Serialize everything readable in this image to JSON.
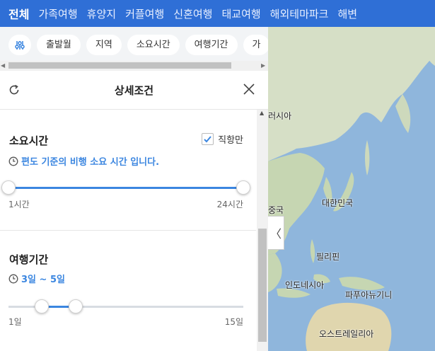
{
  "tabs": [
    "전체",
    "가족여행",
    "휴양지",
    "커플여행",
    "신혼여행",
    "태교여행",
    "해외테마파크",
    "해변"
  ],
  "chips": [
    "출발월",
    "지역",
    "소요시간",
    "여행기간",
    "가"
  ],
  "panel": {
    "title": "상세조건",
    "duration": {
      "title": "소요시간",
      "direct_only": "직항만",
      "direct_checked": true,
      "hint": "편도 기준의 비행 소요 시간 입니다.",
      "min_label": "1시간",
      "max_label": "24시간",
      "range_min": 1,
      "range_max": 24,
      "selected_min": 1,
      "selected_max": 24
    },
    "trip": {
      "title": "여행기간",
      "hint": "3일 ~ 5일",
      "min_label": "1일",
      "max_label": "15일",
      "range_min": 1,
      "range_max": 15,
      "selected_min": 3,
      "selected_max": 5
    }
  },
  "map": {
    "labels": [
      "러시아",
      "중국",
      "대한민국",
      "필리핀",
      "인도네시아",
      "파푸아뉴기니",
      "오스트레일리아"
    ],
    "collapse_glyph": "〈"
  },
  "colors": {
    "accent": "#3b86e0",
    "topbar": "#2f6fd6",
    "sea": "#8fb6dc",
    "land": "#c9d7b8"
  }
}
